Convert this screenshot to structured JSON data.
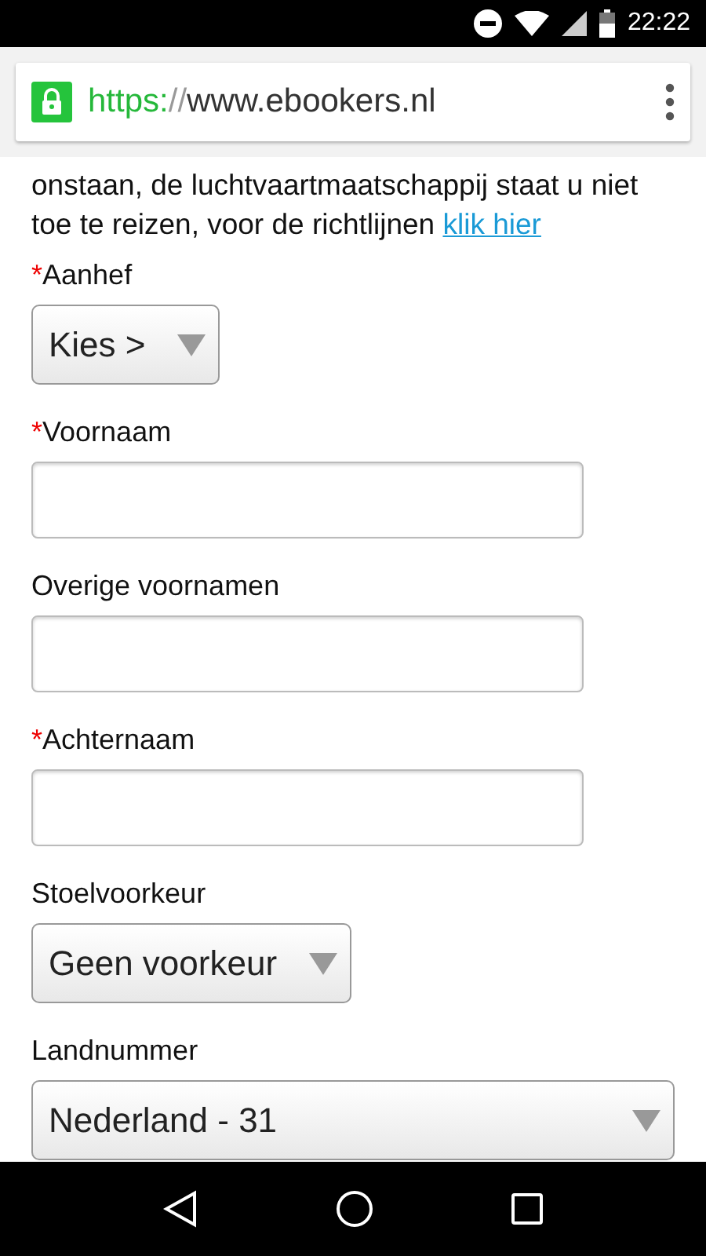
{
  "status_bar": {
    "time": "22:22"
  },
  "address_bar": {
    "scheme": "https:",
    "separator": "//",
    "host": "www.ebookers.nl",
    "secure": true
  },
  "intro": {
    "text": "onstaan, de luchtvaartmaatschappij staat u niet toe te reizen, voor de richtlijnen",
    "link": "klik hier"
  },
  "fields": [
    {
      "kind": "select",
      "label": "Aanhef",
      "marker": "*",
      "value": "Kies >"
    },
    {
      "kind": "text",
      "label": "Voornaam",
      "marker": "*"
    },
    {
      "kind": "text",
      "label": "Overige voornamen"
    },
    {
      "kind": "text",
      "label": "Achternaam",
      "marker": "*"
    },
    {
      "kind": "select",
      "label": "Stoelvoorkeur",
      "value": "Geen voorkeur"
    },
    {
      "kind": "wide_select",
      "label": "Landnummer",
      "value": "Nederland - 31"
    }
  ]
}
